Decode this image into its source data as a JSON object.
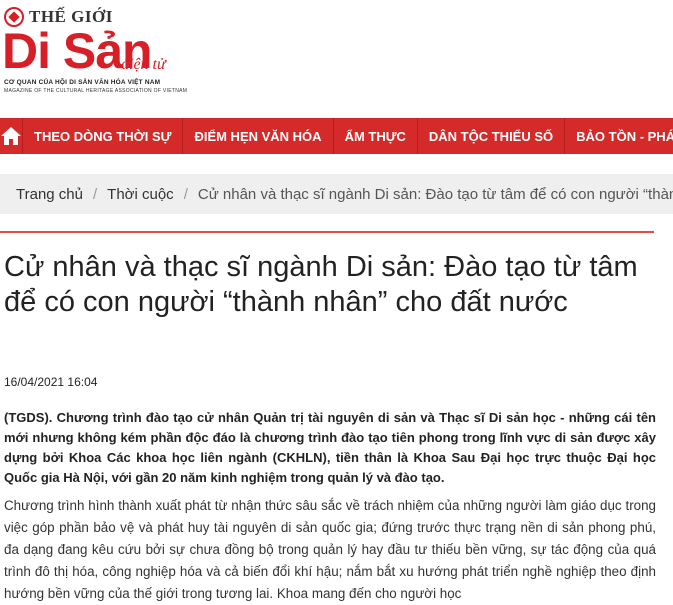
{
  "header": {
    "logo_top": "THẾ GIỚI",
    "logo_main": "Di Sản",
    "logo_sub": "điện tử",
    "logo_org": "CƠ QUAN CỦA HỘI DI SẢN VĂN HÓA VIỆT NAM",
    "logo_mag": "MAGAZINE OF THE CULTURAL HERITAGE ASSOCIATION OF VIETNAM"
  },
  "nav": {
    "home_icon": "home-icon",
    "items": [
      "THEO DÒNG THỜI SỰ",
      "ĐIỂM HẸN VĂN HÓA",
      "ẨM THỰC",
      "DÂN TỘC THIỂU SỐ",
      "BẢO TỒN - PHÁT"
    ]
  },
  "breadcrumb": {
    "home": "Trang chủ",
    "section": "Thời cuộc",
    "current": "Cử nhân và thạc sĩ ngành Di sản: Đào tạo từ tâm để có con người “thành"
  },
  "article": {
    "title": "Cử nhân và thạc sĩ ngành Di sản: Đào tạo từ tâm để có con người “thành nhân” cho đất nước",
    "date": "16/04/2021 16:04",
    "lead": "(TGDS). Chương trình đào tạo cử nhân Quản trị tài nguyên di sản và Thạc sĩ Di sản học - những cái tên mới nhưng không kém phần độc đáo là chương trình đào tạo tiên phong trong lĩnh vực di sản được xây dựng bởi Khoa Các khoa học liên ngành (CKHLN), tiền thân là Khoa Sau Đại học trực thuộc Đại học Quốc gia Hà Nội, với gần 20 năm kinh nghiệm trong quản lý và đào tạo.",
    "body": "Chương trình hình thành xuất phát từ nhận thức sâu sắc về trách nhiệm của những người làm giáo dục trong việc góp phần bảo vệ và phát huy tài nguyên di sản quốc gia; đứng trước thực trạng nền di sản phong phú, đa dạng đang kêu cứu bởi sự chưa đồng bộ trong quản lý hay đầu tư thiếu bền vững, sự tác động của quá trình đô thị hóa, công nghiệp hóa và cả biến đổi khí hậu; nắm bắt xu hướng phát triển nghề nghiệp theo định hướng bền vững của thế giới trong tương lai. Khoa mang đến cho người học"
  },
  "colors": {
    "brand_red": "#d61f26",
    "nav_bg": "#d42a2a",
    "breadcrumb_bg": "#efefef"
  }
}
